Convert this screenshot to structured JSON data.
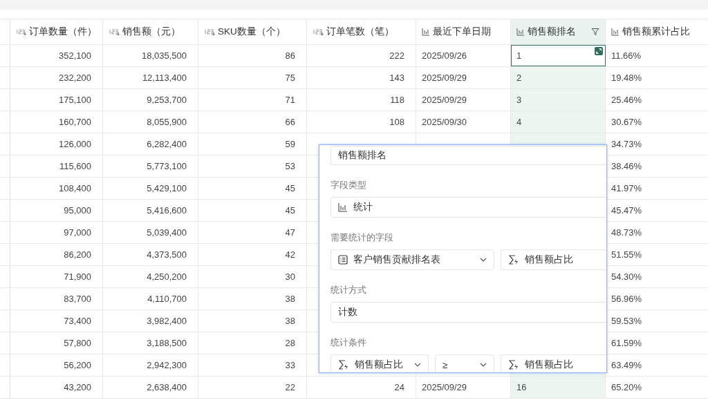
{
  "table": {
    "columns": [
      {
        "label": "订单数量（件）",
        "kind": "number",
        "selected": false,
        "filtered": false
      },
      {
        "label": "销售额（元）",
        "kind": "number",
        "selected": false,
        "filtered": false
      },
      {
        "label": "SKU数量（个）",
        "kind": "number",
        "selected": false,
        "filtered": false
      },
      {
        "label": "订单笔数（笔）",
        "kind": "number",
        "selected": false,
        "filtered": false
      },
      {
        "label": "最近下单日期",
        "kind": "stat",
        "selected": false,
        "filtered": false
      },
      {
        "label": "销售额排名",
        "kind": "stat",
        "selected": true,
        "filtered": true
      },
      {
        "label": "销售额累计占比",
        "kind": "stat",
        "selected": false,
        "filtered": false
      }
    ],
    "rows": [
      {
        "selected": true,
        "cells": [
          "352,100",
          "18,035,500",
          "86",
          "222",
          "2025/09/26",
          "1",
          "11.66%"
        ]
      },
      {
        "selected": false,
        "cells": [
          "232,200",
          "12,113,400",
          "75",
          "143",
          "2025/09/29",
          "2",
          "19.48%"
        ]
      },
      {
        "selected": false,
        "cells": [
          "175,100",
          "9,253,700",
          "71",
          "118",
          "2025/09/29",
          "3",
          "25.46%"
        ]
      },
      {
        "selected": false,
        "cells": [
          "160,700",
          "8,055,900",
          "66",
          "108",
          "2025/09/30",
          "4",
          "30.67%"
        ]
      },
      {
        "selected": false,
        "cells": [
          "126,000",
          "6,282,400",
          "59",
          null,
          null,
          null,
          "34.73%"
        ]
      },
      {
        "selected": false,
        "cells": [
          "115,600",
          "5,773,100",
          "53",
          null,
          null,
          null,
          "38.46%"
        ]
      },
      {
        "selected": false,
        "cells": [
          "108,400",
          "5,429,100",
          "45",
          null,
          null,
          null,
          "41.97%"
        ]
      },
      {
        "selected": false,
        "cells": [
          "95,000",
          "5,416,600",
          "45",
          null,
          null,
          null,
          "45.47%"
        ]
      },
      {
        "selected": false,
        "cells": [
          "97,000",
          "5,039,400",
          "47",
          null,
          null,
          null,
          "48.73%"
        ]
      },
      {
        "selected": false,
        "cells": [
          "86,200",
          "4,373,500",
          "42",
          null,
          null,
          null,
          "51.55%"
        ]
      },
      {
        "selected": false,
        "cells": [
          "71,900",
          "4,250,200",
          "30",
          null,
          null,
          null,
          "54.30%"
        ]
      },
      {
        "selected": false,
        "cells": [
          "83,700",
          "4,110,700",
          "38",
          null,
          null,
          null,
          "56.96%"
        ]
      },
      {
        "selected": false,
        "cells": [
          "73,400",
          "3,982,400",
          "38",
          null,
          null,
          null,
          "59.53%"
        ]
      },
      {
        "selected": false,
        "cells": [
          "57,800",
          "3,188,500",
          "28",
          null,
          null,
          null,
          "61.59%"
        ]
      },
      {
        "selected": false,
        "cells": [
          "56,200",
          "2,942,300",
          "33",
          null,
          null,
          null,
          "63.49%"
        ]
      },
      {
        "selected": false,
        "cells": [
          "43,200",
          "2,638,400",
          "22",
          "24",
          "2025/09/29",
          "16",
          "65.20%"
        ]
      }
    ]
  },
  "field_editor": {
    "name": "销售额排名",
    "sections": [
      {
        "label": "字段类型",
        "controls": [
          {
            "kind": "type",
            "value": "统计"
          }
        ]
      },
      {
        "label": "需要统计的字段",
        "controls": [
          {
            "kind": "table",
            "value": "客户销售贡献排名表",
            "dropdown": true
          },
          {
            "kind": "field",
            "value": "销售额占比"
          }
        ]
      },
      {
        "label": "统计方式",
        "controls": [
          {
            "kind": "text",
            "value": "计数"
          }
        ]
      },
      {
        "label": "统计条件",
        "controls": [
          {
            "kind": "field",
            "value": "销售额占比",
            "dropdown": true
          },
          {
            "kind": "text",
            "value": "≥",
            "dropdown": true
          },
          {
            "kind": "field",
            "value": "销售额占比"
          }
        ]
      }
    ]
  }
}
